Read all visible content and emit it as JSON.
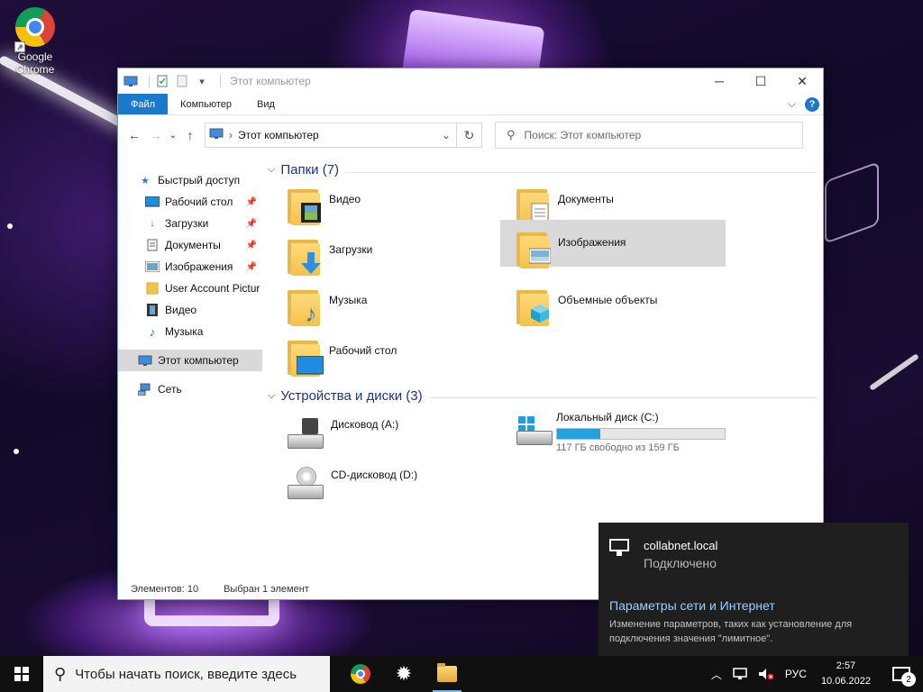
{
  "desktop": {
    "icons": [
      {
        "label": "Google\nChrome",
        "icon": "chrome-icon"
      }
    ]
  },
  "explorer": {
    "title": "Этот компьютер",
    "ribbon_tabs": [
      "Файл",
      "Компьютер",
      "Вид"
    ],
    "address": "Этот компьютер",
    "search_placeholder": "Поиск: Этот компьютер",
    "sidebar": {
      "quick_access": "Быстрый доступ",
      "items": [
        {
          "label": "Рабочий стол",
          "icon": "desktop-icon",
          "pinned": true
        },
        {
          "label": "Загрузки",
          "icon": "download-icon",
          "pinned": true
        },
        {
          "label": "Документы",
          "icon": "documents-icon",
          "pinned": true
        },
        {
          "label": "Изображения",
          "icon": "pictures-icon",
          "pinned": true
        },
        {
          "label": "User Account Pictur",
          "icon": "folder-icon",
          "pinned": false
        },
        {
          "label": "Видео",
          "icon": "video-icon",
          "pinned": false
        },
        {
          "label": "Музыка",
          "icon": "music-icon",
          "pinned": false
        }
      ],
      "this_pc": "Этот компьютер",
      "network": "Сеть"
    },
    "folders_header": "Папки (7)",
    "folders": [
      {
        "label": "Видео",
        "icon": "video-folder-icon"
      },
      {
        "label": "Документы",
        "icon": "documents-folder-icon"
      },
      {
        "label": "Загрузки",
        "icon": "downloads-folder-icon"
      },
      {
        "label": "Изображения",
        "icon": "pictures-folder-icon",
        "selected": true
      },
      {
        "label": "Музыка",
        "icon": "music-folder-icon"
      },
      {
        "label": "Объемные объекты",
        "icon": "3d-objects-folder-icon"
      },
      {
        "label": "Рабочий стол",
        "icon": "desktop-folder-icon"
      }
    ],
    "devices_header": "Устройства и диски (3)",
    "devices": [
      {
        "label": "Дисковод (A:)",
        "icon": "floppy-drive-icon"
      },
      {
        "label": "Локальный диск (C:)",
        "icon": "local-disk-icon",
        "free_text": "117 ГБ свободно из 159 ГБ",
        "used_fraction": 0.26
      },
      {
        "label": "CD-дисковод (D:)",
        "icon": "cd-drive-icon"
      }
    ],
    "status": {
      "items_count": "Элементов: 10",
      "selected": "Выбран 1 элемент"
    }
  },
  "network_flyout": {
    "network_name": "collabnet.local",
    "status": "Подключено",
    "settings_link": "Параметры сети и Интернет",
    "description": "Изменение параметров, таких как установление для подключения значения \"лимитное\"."
  },
  "taskbar": {
    "search_placeholder": "Чтобы начать поиск, введите здесь",
    "language": "РУС",
    "time": "2:57",
    "date": "10.06.2022",
    "notification_count": "2"
  }
}
